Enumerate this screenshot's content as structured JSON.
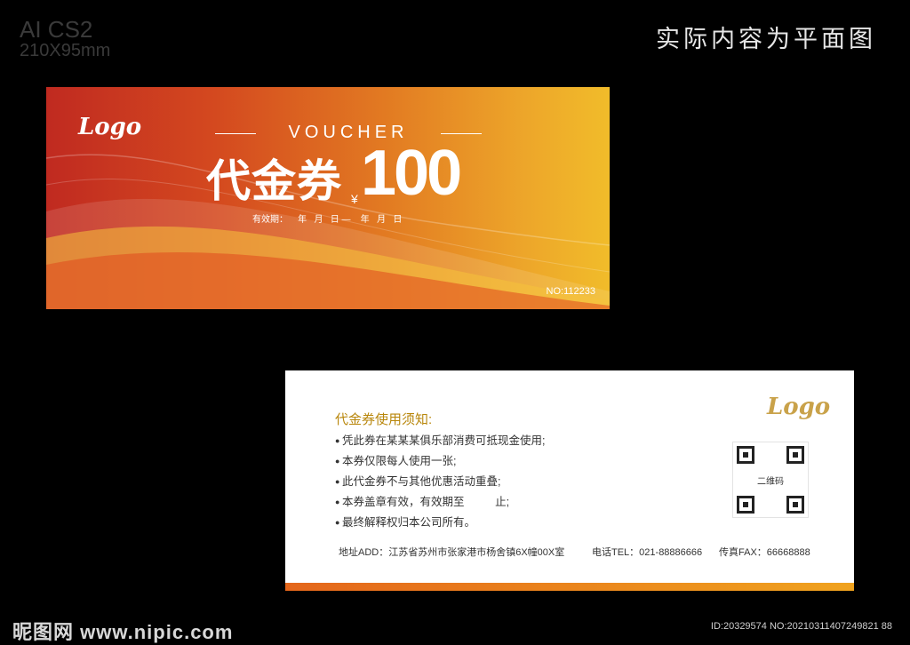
{
  "spec": {
    "software": "AI CS2",
    "size": "210X95mm"
  },
  "top_caption": "实际内容为平面图",
  "front": {
    "logo": "Logo",
    "voucher_word": "VOUCHER",
    "title": "代金券",
    "currency": "¥",
    "amount": "100",
    "validity": "有效期：    年   月   日 —    年   月   日",
    "serial": "NO:112233",
    "colors": {
      "start": "#c02a20",
      "mid": "#e27a22",
      "end": "#f1bc2a"
    }
  },
  "back": {
    "logo": "Logo",
    "notice_title": "代金券使用须知:",
    "rules": [
      "凭此券在某某某俱乐部消费可抵现金使用;",
      "本券仅限每人使用一张;",
      "此代金券不与其他优惠活动重叠;",
      "本券盖章有效，有效期至          止;",
      "最终解释权归本公司所有。"
    ],
    "qr_label": "二维码",
    "address": "地址ADD：江苏省苏州市张家港市杨舍镇6X幢00X室",
    "phone": "电话TEL：021-88886666",
    "fax": "传真FAX：66668888"
  },
  "watermark": "昵图网 www.nipic.com",
  "image_id": "ID:20329574 NO:20210311407249821 88"
}
